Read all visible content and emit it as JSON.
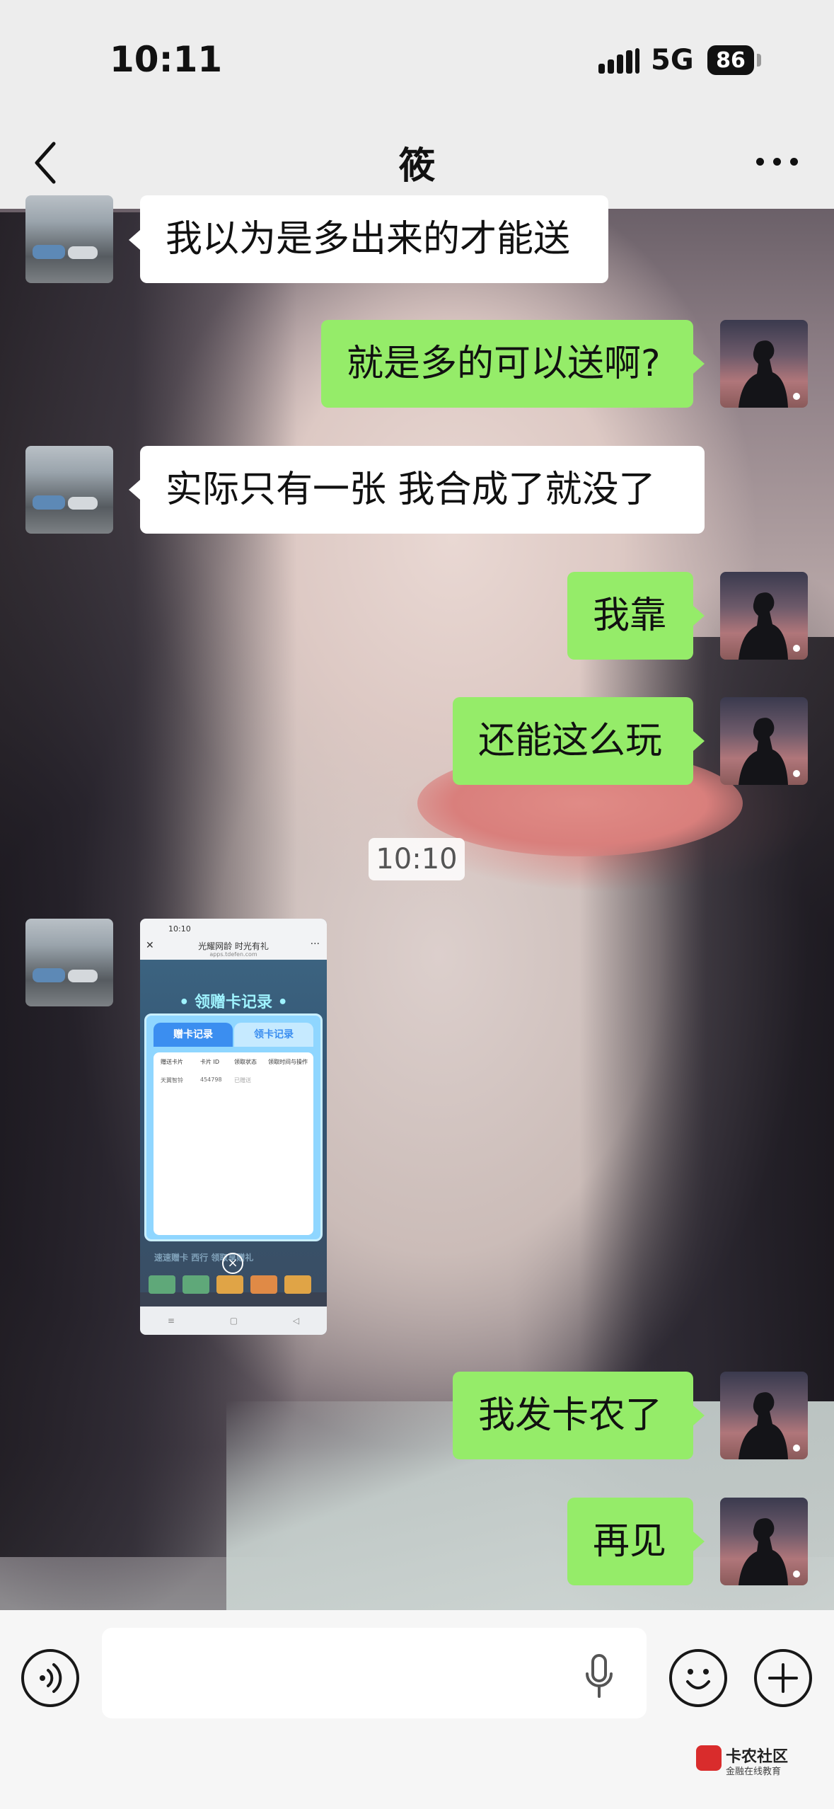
{
  "status_bar": {
    "time": "10:11",
    "network": "5G",
    "battery": "86"
  },
  "header": {
    "title": "筱"
  },
  "messages": [
    {
      "side": "left",
      "text": "我以为是多出来的才能送"
    },
    {
      "side": "right",
      "text": "就是多的可以送啊?"
    },
    {
      "side": "left",
      "text": "实际只有一张  我合成了就没了"
    },
    {
      "side": "right",
      "text": "我靠"
    },
    {
      "side": "right",
      "text": "还能这么玩"
    },
    {
      "side": "right",
      "text": "我发卡农了"
    },
    {
      "side": "right",
      "text": "再见"
    }
  ],
  "timestamp": "10:10",
  "image_message": {
    "status_time": "10:10",
    "page_title": "光耀网龄 时光有礼",
    "page_url": "apps.tdefen.com",
    "banner": "• 领赠卡记录 •",
    "tab_active": "赠卡记录",
    "tab_inactive": "领卡记录",
    "columns": [
      "赠送卡片",
      "卡片 ID",
      "领取状态",
      "领取时间与操作"
    ],
    "row": [
      "天翼智铃",
      "454798",
      "已赠送"
    ],
    "lower_text": "速速赠卡 西行 领取享赠礼",
    "nav_buttons": [
      "≡",
      "▢",
      "◁"
    ]
  },
  "input_bar": {
    "placeholder": ""
  },
  "watermark": {
    "title": "卡农社区",
    "subtitle": "金融在线教育"
  },
  "colors": {
    "bubble_green": "#95ec69",
    "bubble_white": "#ffffff",
    "header_bg": "#ededed"
  },
  "icons": {
    "back": "chevron-left-icon",
    "more": "more-dots-icon",
    "voice": "voice-icon",
    "mic": "mic-icon",
    "emoji": "emoji-icon",
    "plus": "plus-icon"
  }
}
